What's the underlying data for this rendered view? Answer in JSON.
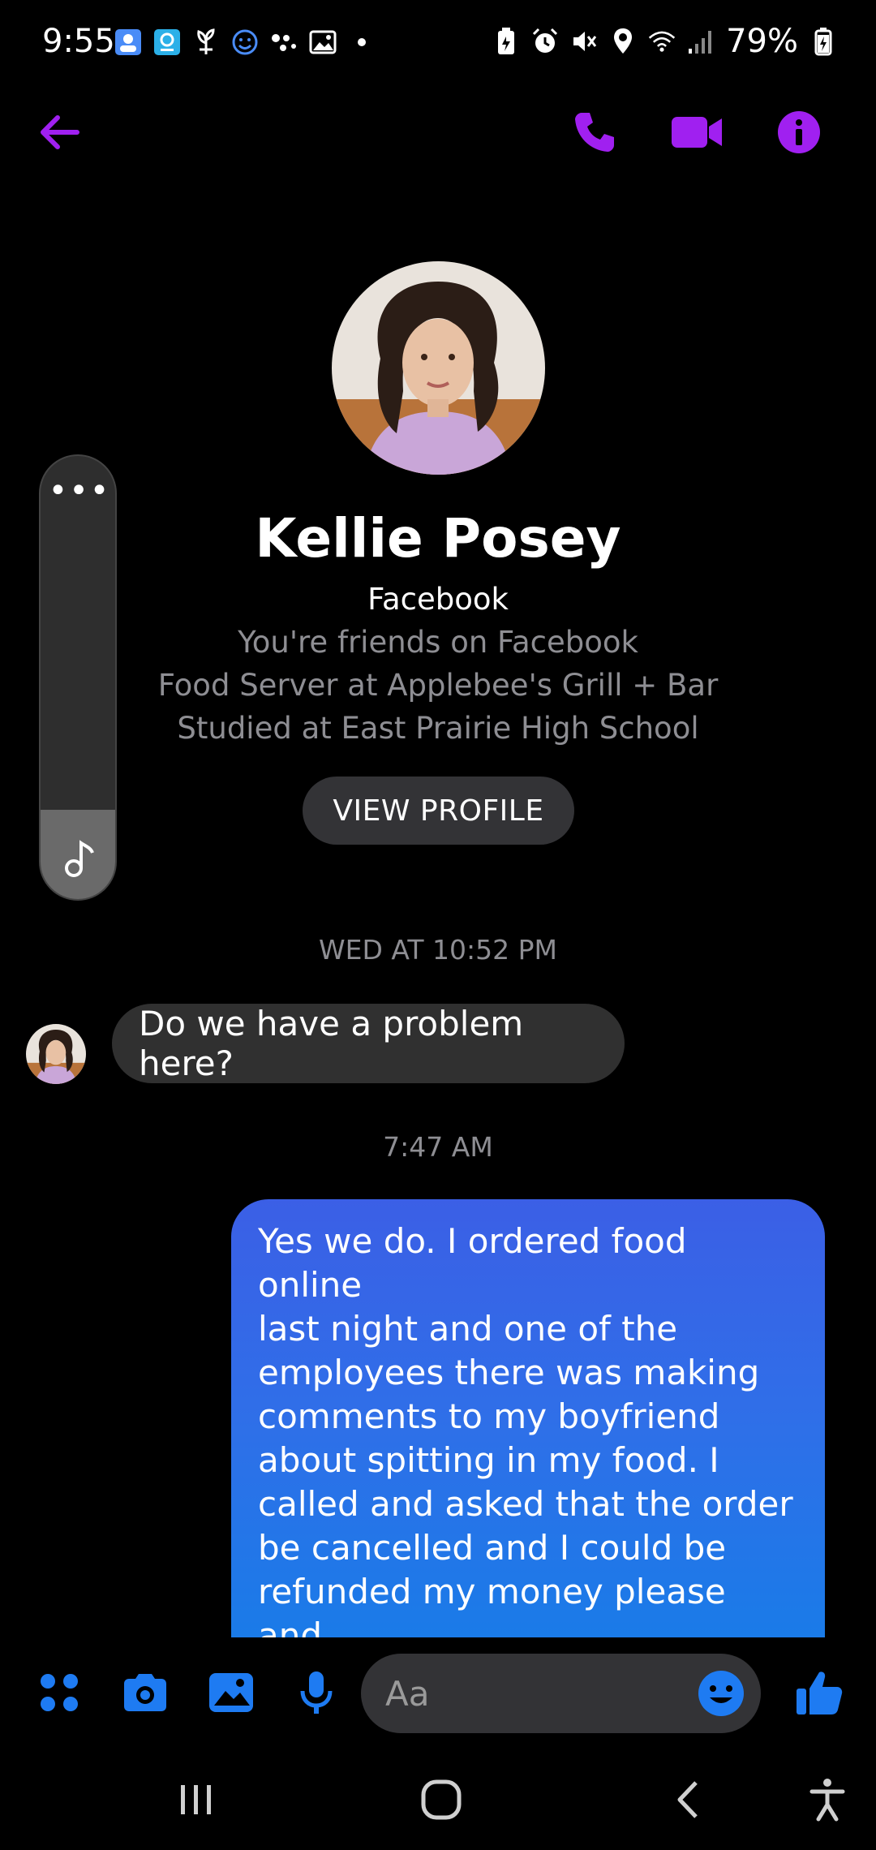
{
  "status_bar": {
    "time": "9:55",
    "battery": "79%",
    "left_icons": [
      "contact-card-icon",
      "webcam-icon",
      "plant-icon",
      "smiley-icon",
      "dots-cluster-icon",
      "image-icon",
      "dot-icon"
    ],
    "right_icons": [
      "battery-saver-icon",
      "alarm-icon",
      "mute-icon",
      "location-icon",
      "wifi-icon",
      "signal-icon"
    ]
  },
  "header": {
    "back_icon": "arrow-left-icon",
    "call_icon": "phone-icon",
    "video_icon": "video-camera-icon",
    "info_icon": "info-icon",
    "accent_color": "#a020f0"
  },
  "profile": {
    "name": "Kellie Posey",
    "source": "Facebook",
    "lines": [
      "You're friends on Facebook",
      "Food Server at Applebee's Grill + Bar",
      "Studied at East Prairie High School"
    ],
    "view_profile_label": "VIEW PROFILE"
  },
  "side_panel": {
    "menu_glyph": "•••",
    "note_icon": "music-note-icon",
    "level_fraction": 0.2
  },
  "conversation": {
    "timestamp_1": "WED AT 10:52 PM",
    "incoming_message": "Do we have a problem here?",
    "timestamp_2": "7:47 AM",
    "outgoing_message": "Yes we do. I ordered food online\nlast night and one of the\nemployees there was making\ncomments to my boyfriend\nabout spitting in my food. I\ncalled and asked that the order\nbe cancelled and I could be\nrefunded my money please and\nthe cook hung up the phone on\nme."
  },
  "composer": {
    "placeholder": "Aa",
    "icons": [
      "apps-grid-icon",
      "camera-icon",
      "gallery-icon",
      "microphone-icon",
      "emoji-icon",
      "thumbs-up-icon"
    ],
    "accent_color": "#1e7bf2"
  },
  "navbar": {
    "icons": [
      "recent-apps-icon",
      "home-icon",
      "back-icon",
      "accessibility-icon"
    ]
  }
}
